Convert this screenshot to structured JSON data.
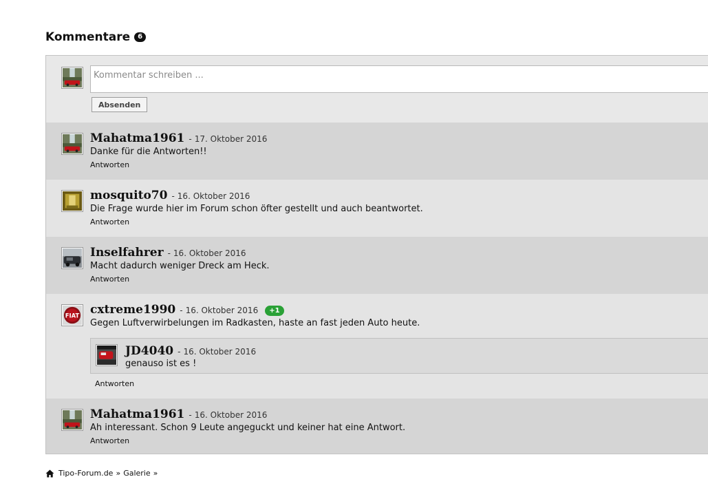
{
  "section": {
    "title": "Kommentare",
    "count": "6"
  },
  "compose": {
    "placeholder": "Kommentar schreiben ...",
    "value": "",
    "send_label": "Absenden"
  },
  "reply_label": "Antworten",
  "date_separator": "-",
  "comments": [
    {
      "author": "Mahatma1961",
      "date": "17. Oktober 2016",
      "text": "Danke für die Antworten!!",
      "avatar": "waterfall-car-avatar",
      "reply": "Antworten"
    },
    {
      "author": "mosquito70",
      "date": "16. Oktober 2016",
      "text": "Die Frage wurde hier im Forum schon öfter gestellt und auch beantwortet.",
      "avatar": "gold-avatar",
      "reply": "Antworten"
    },
    {
      "author": "Inselfahrer",
      "date": "16. Oktober 2016",
      "text": "Macht dadurch weniger Dreck am Heck.",
      "avatar": "car-photo-avatar",
      "reply": "Antworten"
    },
    {
      "author": "cxtreme1990",
      "date": "16. Oktober 2016",
      "likes": "+1",
      "text": "Gegen Luftverwirbelungen im Radkasten, haste an fast jeden Auto heute.",
      "avatar": "fiat-logo-avatar",
      "reply": "Antworten",
      "replies": [
        {
          "author": "JD4040",
          "date": "16. Oktober 2016",
          "text": "genauso ist es !",
          "avatar": "red-car-avatar"
        }
      ]
    },
    {
      "author": "Mahatma1961",
      "date": "16. Oktober 2016",
      "text": "Ah interessant. Schon 9 Leute angeguckt und keiner hat eine Antwort.",
      "avatar": "waterfall-car-avatar",
      "reply": "Antworten"
    }
  ],
  "breadcrumb": {
    "items": [
      "Tipo-Forum.de",
      "Galerie"
    ],
    "separator": "»"
  },
  "colors": {
    "panel_bg": "#e8e8e8",
    "row_dark": "#d5d5d5",
    "row_light": "#e4e4e4",
    "like_badge": "#2aa136"
  }
}
